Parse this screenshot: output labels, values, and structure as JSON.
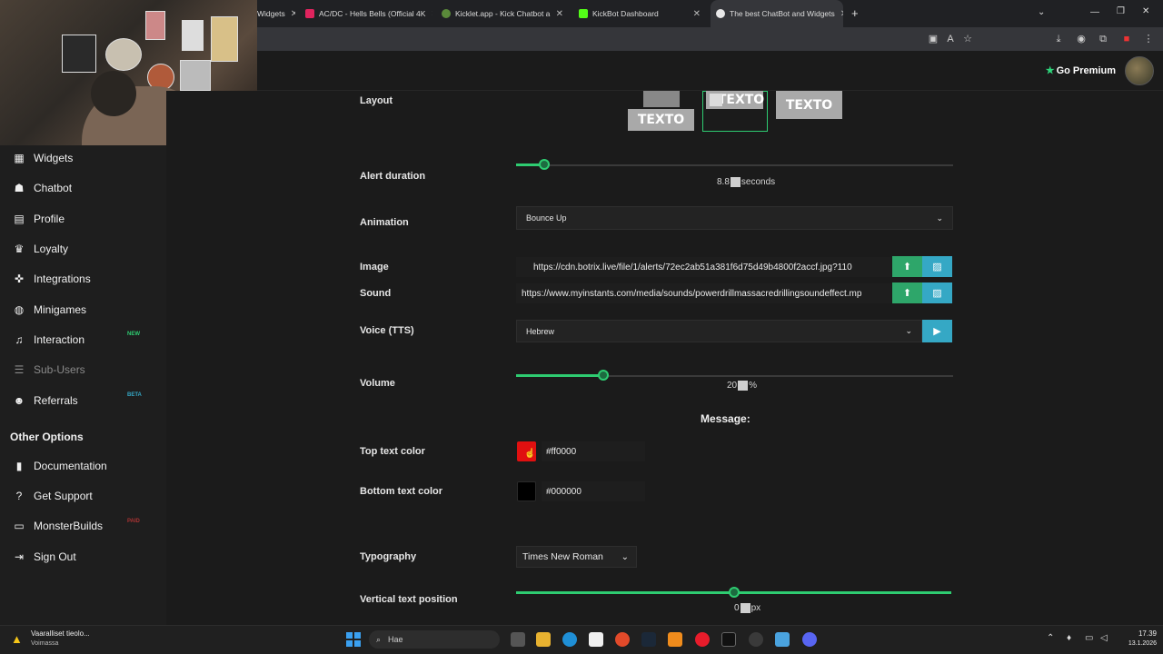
{
  "browser": {
    "tabs": [
      {
        "label": "Widgets",
        "active": false
      },
      {
        "label": "AC/DC - Hells Bells (Official 4K",
        "active": false
      },
      {
        "label": "Kicklet.app - Kick Chatbot a",
        "active": false
      },
      {
        "label": "KickBot Dashboard",
        "active": false
      },
      {
        "label": "The best ChatBot and Widgets",
        "active": true
      }
    ],
    "new_tab_icon": "plus-icon"
  },
  "header": {
    "premium_label": "Go Premium",
    "premium_icon": "star-icon"
  },
  "sidebar": {
    "items": [
      {
        "label": "Widgets",
        "icon": "grid-icon"
      },
      {
        "label": "Chatbot",
        "icon": "robot-icon"
      },
      {
        "label": "Profile",
        "icon": "id-card-icon"
      },
      {
        "label": "Loyalty",
        "icon": "trophy-icon"
      },
      {
        "label": "Integrations",
        "icon": "puzzle-icon"
      },
      {
        "label": "Minigames",
        "icon": "gamepad-icon"
      },
      {
        "label": "Interaction",
        "icon": "music-note-icon",
        "badge": "NEW"
      },
      {
        "label": "Sub-Users",
        "icon": "users-icon",
        "disabled": true
      },
      {
        "label": "Referrals",
        "icon": "user-plus-icon",
        "badge": "BETA"
      }
    ],
    "other_options_title": "Other Options",
    "other_items": [
      {
        "label": "Documentation",
        "icon": "book-icon"
      },
      {
        "label": "Get Support",
        "icon": "question-icon"
      },
      {
        "label": "MonsterBuilds",
        "icon": "monitor-icon",
        "badge": "PAID"
      },
      {
        "label": "Sign Out",
        "icon": "sign-out-icon"
      }
    ]
  },
  "form": {
    "layout": {
      "label": "Layout",
      "options": [
        "TEXTO",
        "TEXTO",
        "TEXTO"
      ],
      "selected_index": 1
    },
    "alert_duration": {
      "label": "Alert duration",
      "value": "8.8",
      "unit": "seconds",
      "fraction": 0.065
    },
    "animation": {
      "label": "Animation",
      "value": "Bounce Up"
    },
    "image": {
      "label": "Image",
      "value": "https://cdn.botrix.live/file/1/alerts/72ec2ab51a381f6d75d49b4800f2accf.jpg?110"
    },
    "sound": {
      "label": "Sound",
      "value": "https://www.myinstants.com/media/sounds/powerdrillmassacredrillingsoundeffect.mp"
    },
    "voice": {
      "label": "Voice (TTS)",
      "value": "Hebrew"
    },
    "volume": {
      "label": "Volume",
      "value": "20",
      "unit": "%",
      "fraction": 0.2
    },
    "message_heading": "Message:",
    "top_text_color": {
      "label": "Top text color",
      "value": "#ff0000",
      "swatch": "#e01010"
    },
    "bottom_text_color": {
      "label": "Bottom text color",
      "value": "#000000",
      "swatch": "#000000"
    },
    "typography": {
      "label": "Typography",
      "value": "Times New Roman"
    },
    "vertical_text_position": {
      "label": "Vertical text position",
      "value": "0",
      "unit": "px",
      "fraction": 0.5
    }
  },
  "taskbar": {
    "notification_title": "Vaaralliset tieolo...",
    "notification_sub": "Voimassa",
    "search_placeholder": "Hae",
    "time": "17.39",
    "date": "13.1.2026"
  },
  "colors": {
    "accent_green": "#2ecc71",
    "button_green": "#2ea66a",
    "button_teal": "#35a8c5",
    "background": "#1b1b1b"
  }
}
